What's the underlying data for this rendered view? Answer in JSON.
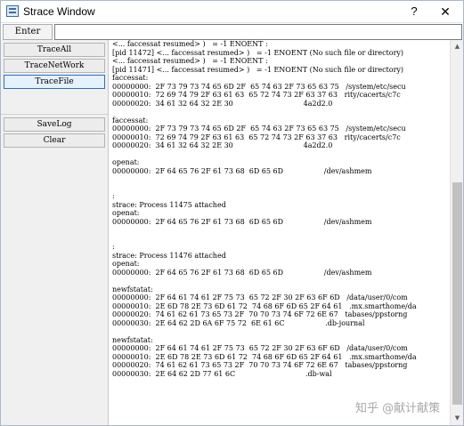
{
  "window": {
    "title": "Strace Window",
    "help_label": "?",
    "close_label": "✕"
  },
  "toolbar": {
    "enter_label": "Enter",
    "command_value": ""
  },
  "sidebar": {
    "buttons": [
      {
        "label": "TraceAll"
      },
      {
        "label": "TraceNetWork"
      },
      {
        "label": "TraceFile",
        "selected": true
      },
      {
        "label": "SaveLog"
      },
      {
        "label": "Clear"
      }
    ]
  },
  "output": {
    "lines": [
      "<... faccessat resumed> )   = -1 ENOENT :",
      "[pid 11472] <... faccessat resumed> )   = -1 ENOENT (No such file or directory)",
      "<... faccessat resumed> )   = -1 ENOENT :",
      "[pid 11471] <... faccessat resumed> )   = -1 ENOENT (No such file or directory)",
      "faccessat:",
      "00000000:  2F 73 79 73 74 65 6D 2F  65 74 63 2F 73 65 63 75   /system/etc/secu",
      "00000010:  72 69 74 79 2F 63 61 63  65 72 74 73 2F 63 37 63   rity/cacerts/c7c",
      "00000020:  34 61 32 64 32 2E 30                               4a2d2.0",
      "",
      "faccessat:",
      "00000000:  2F 73 79 73 74 65 6D 2F  65 74 63 2F 73 65 63 75   /system/etc/secu",
      "00000010:  72 69 74 79 2F 63 61 63  65 72 74 73 2F 63 37 63   rity/cacerts/c7c",
      "00000020:  34 61 32 64 32 2E 30                               4a2d2.0",
      "",
      "openat:",
      "00000000:  2F 64 65 76 2F 61 73 68  6D 65 6D                  /dev/ashmem",
      "",
      "",
      ":",
      "strace: Process 11475 attached",
      "openat:",
      "00000000:  2F 64 65 76 2F 61 73 68  6D 65 6D                  /dev/ashmem",
      "",
      "",
      ":",
      "strace: Process 11476 attached",
      "openat:",
      "00000000:  2F 64 65 76 2F 61 73 68  6D 65 6D                  /dev/ashmem",
      "",
      "newfstatat:",
      "00000000:  2F 64 61 74 61 2F 75 73  65 72 2F 30 2F 63 6F 6D   /data/user/0/com",
      "00000010:  2E 6D 78 2E 73 6D 61 72  74 68 6F 6D 65 2F 64 61   .mx.smarthome/da",
      "00000020:  74 61 62 61 73 65 73 2F  70 70 73 74 6F 72 6E 67   tabases/ppstorng",
      "00000030:  2E 64 62 2D 6A 6F 75 72  6E 61 6C                  .db-journal",
      "",
      "newfstatat:",
      "00000000:  2F 64 61 74 61 2F 75 73  65 72 2F 30 2F 63 6F 6D   /data/user/0/com",
      "00000010:  2E 6D 78 2E 73 6D 61 72  74 68 6F 6D 65 2F 64 61   .mx.smarthome/da",
      "00000020:  74 61 62 61 73 65 73 2F  70 70 73 74 6F 72 6E 67   tabases/ppstorng",
      "00000030:  2E 64 62 2D 77 61 6C                               .db-wal"
    ]
  },
  "scrollbar": {
    "up_icon": "▲",
    "down_icon": "▼",
    "thumb_start_fraction": 0.36,
    "thumb_size_fraction": 0.62
  },
  "watermark": {
    "text": "知乎 @献计献策"
  }
}
